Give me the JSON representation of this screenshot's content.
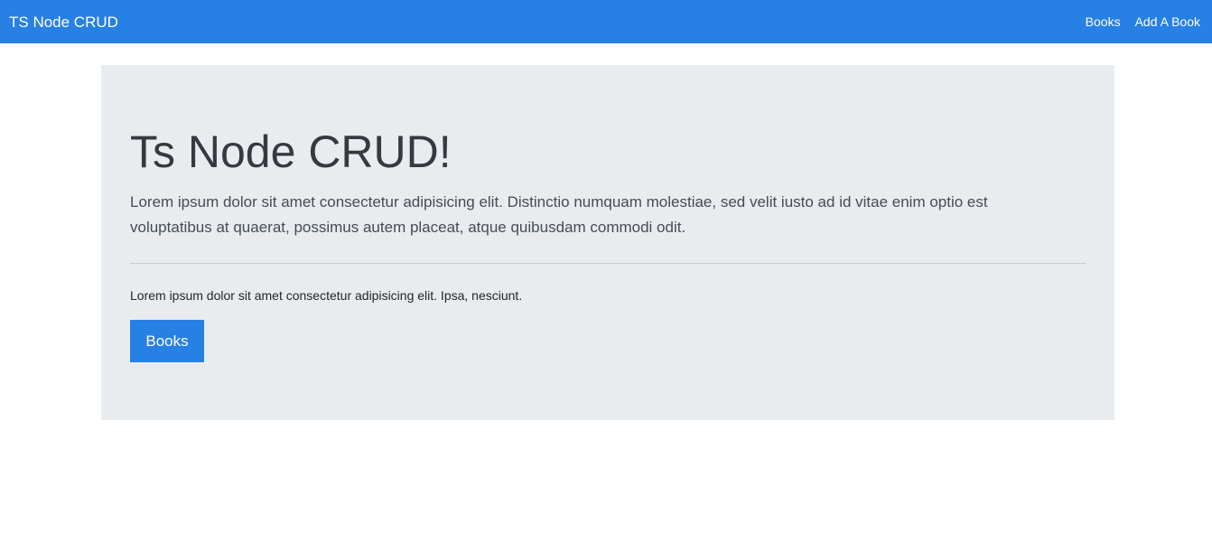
{
  "navbar": {
    "brand": "TS Node CRUD",
    "links": [
      {
        "label": "Books"
      },
      {
        "label": "Add A Book"
      }
    ],
    "background": "#2780e3"
  },
  "jumbotron": {
    "title": "Ts Node CRUD!",
    "lead": "Lorem ipsum dolor sit amet consectetur adipisicing elit. Distinctio numquam molestiae, sed velit iusto ad id vitae enim optio est voluptatibus at quaerat, possimus autem placeat, atque quibusdam commodi odit.",
    "body": "Lorem ipsum dolor sit amet consectetur adipisicing elit. Ipsa, nesciunt.",
    "button_label": "Books",
    "background": "#e9ecef"
  },
  "colors": {
    "primary": "#2780e3",
    "jumbotron_bg": "#e9ecef",
    "text": "#343a40"
  }
}
